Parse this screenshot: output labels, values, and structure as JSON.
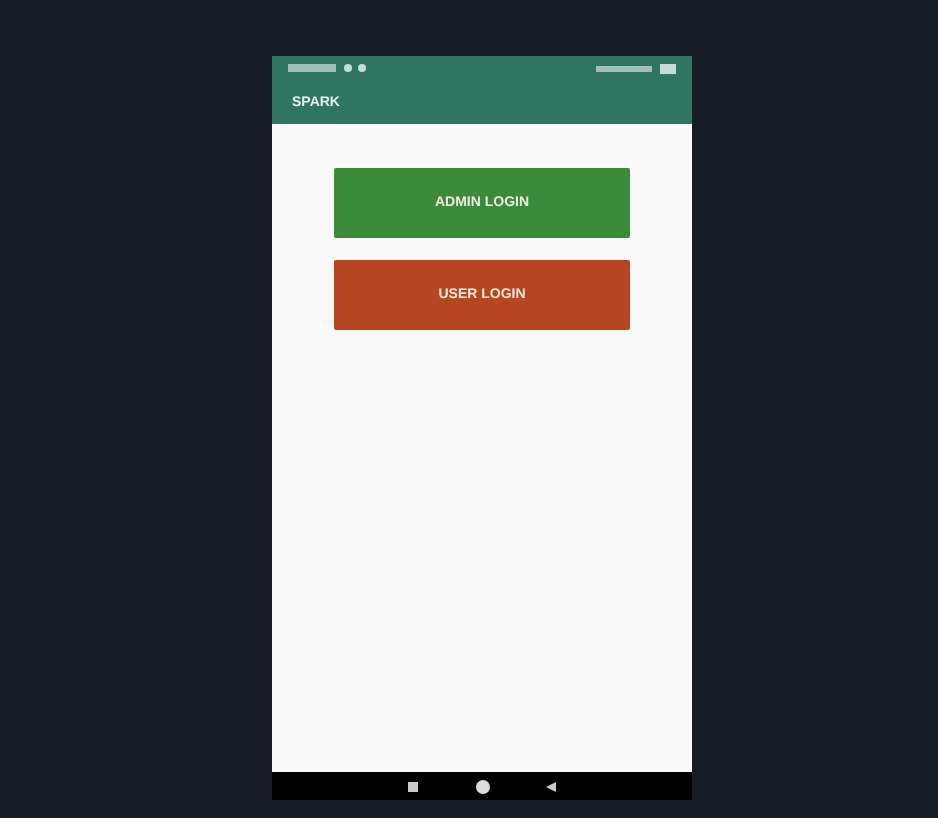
{
  "app_bar": {
    "title": "SPARK"
  },
  "buttons": [
    {
      "label": "ADMIN LOGIN",
      "color": "#3b8c3a"
    },
    {
      "label": "USER LOGIN",
      "color": "#b5461f"
    }
  ]
}
